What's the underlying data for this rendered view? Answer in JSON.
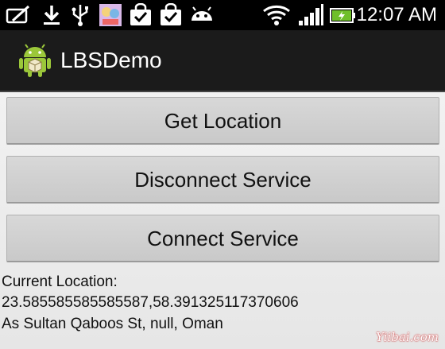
{
  "status_bar": {
    "time": "12:07 AM",
    "icons": [
      "sync-icon",
      "download-icon",
      "usb-icon",
      "app-thumbnail-icon",
      "check-bag-icon",
      "check-bag-icon",
      "android-debug-icon",
      "wifi-icon",
      "signal-icon",
      "battery-charging-icon"
    ]
  },
  "action_bar": {
    "title": "LBSDemo",
    "icon": "android-app-icon"
  },
  "buttons": {
    "get_location": "Get Location",
    "disconnect_service": "Disconnect Service",
    "connect_service": "Connect Service"
  },
  "location": {
    "label": "Current Location:",
    "coordinates": "23.585585585585587,58.391325117370606",
    "address": "As Sultan Qaboos St, null, Oman"
  },
  "watermark": "Yiibai.com"
}
